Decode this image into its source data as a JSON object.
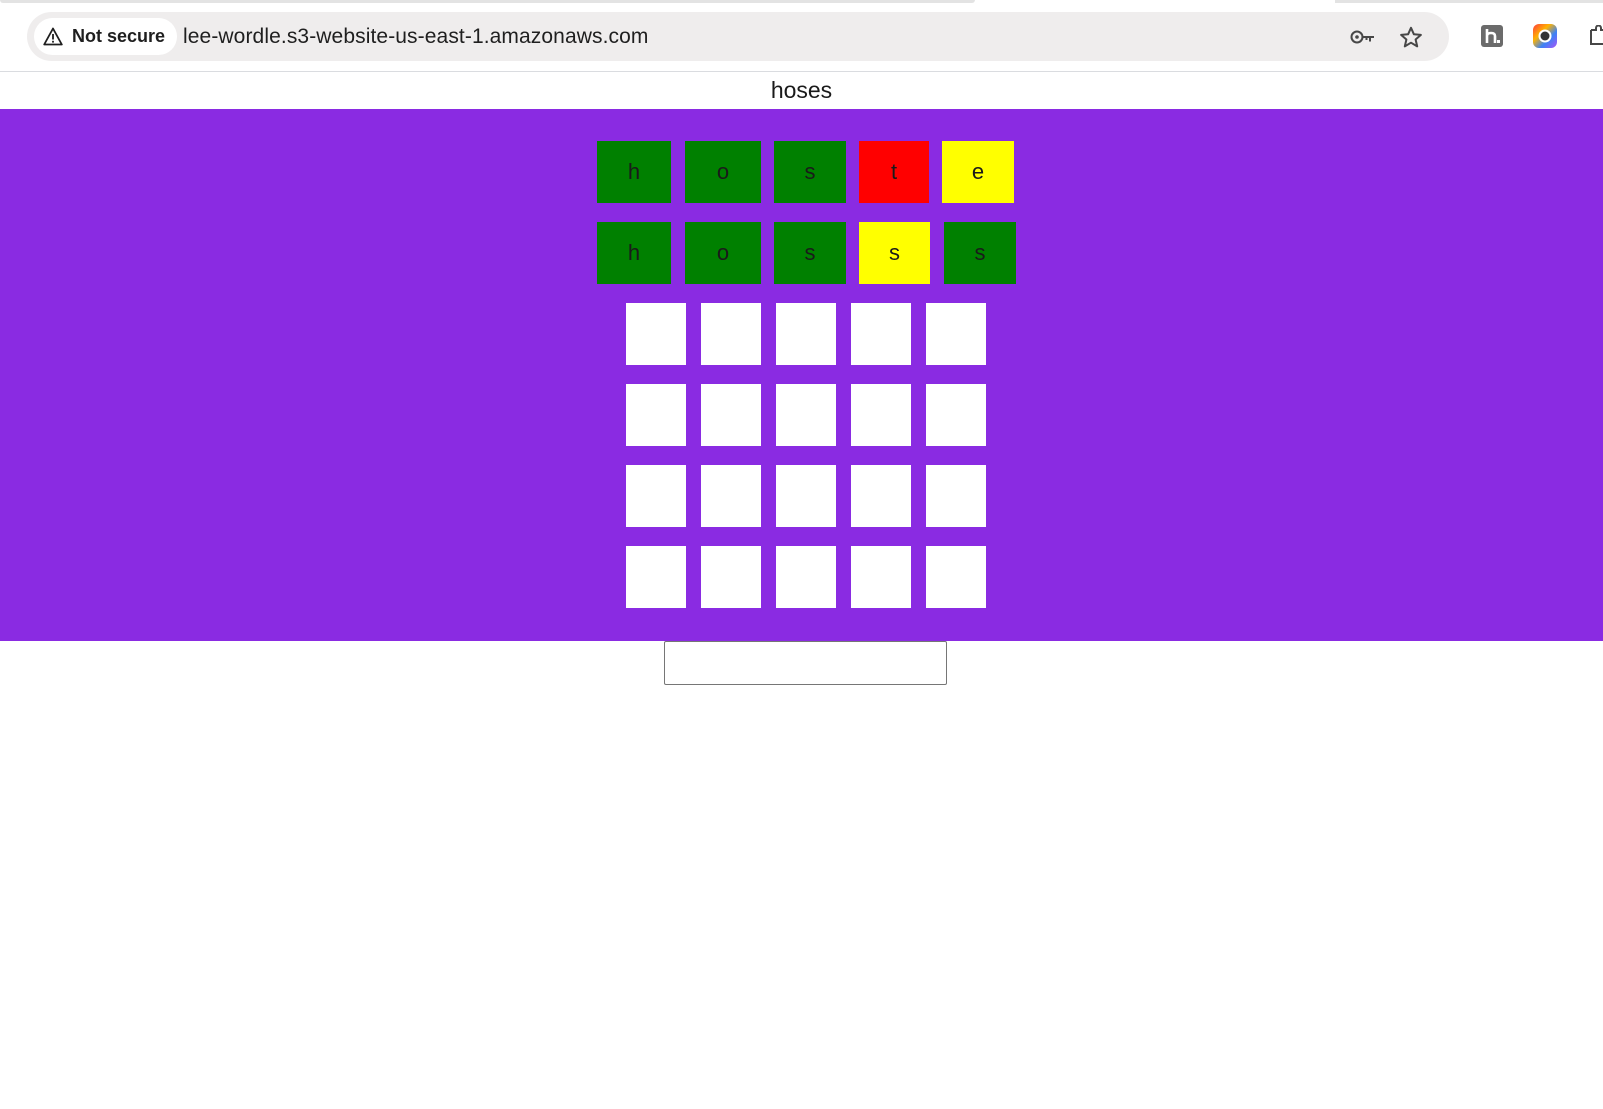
{
  "browser": {
    "security_label": "Not secure",
    "url": "lee-wordle.s3-website-us-east-1.amazonaws.com",
    "icons": [
      "warning-triangle-icon",
      "key-icon",
      "star-icon",
      "h-extension-icon",
      "color-extension-icon",
      "puzzle-extension-icon"
    ]
  },
  "game": {
    "answer": "hoses",
    "colors": {
      "board_bg": "#8a2be2",
      "correct": "#008000",
      "absent": "#ff0000",
      "present": "#ffff00",
      "empty": "#ffffff"
    },
    "guesses": [
      {
        "letters": [
          "h",
          "o",
          "s",
          "t",
          "e"
        ],
        "states": [
          "correct",
          "correct",
          "correct",
          "absent",
          "present"
        ]
      },
      {
        "letters": [
          "h",
          "o",
          "s",
          "s",
          "s"
        ],
        "states": [
          "correct",
          "correct",
          "correct",
          "present",
          "correct"
        ]
      }
    ],
    "empty_rows": 4,
    "letters_per_row": 5,
    "input_value": ""
  }
}
